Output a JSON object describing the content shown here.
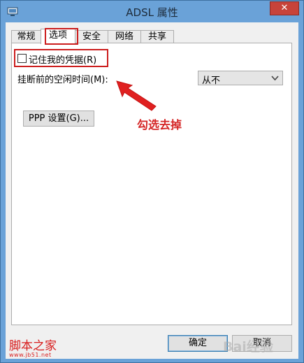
{
  "window": {
    "title": "ADSL 属性",
    "close_glyph": "✕",
    "icon": "network-connection-icon"
  },
  "tabs": [
    {
      "label": "常规",
      "active": false
    },
    {
      "label": "选项",
      "active": true
    },
    {
      "label": "安全",
      "active": false
    },
    {
      "label": "网络",
      "active": false
    },
    {
      "label": "共享",
      "active": false
    }
  ],
  "options": {
    "remember_credentials_label": "记住我的凭据(R)",
    "remember_credentials_checked": false,
    "idle_label": "挂断前的空闲时间(M):",
    "idle_value": "从不",
    "ppp_button": "PPP 设置(G)..."
  },
  "annotation": {
    "text": "勾选去掉",
    "color": "#d42323"
  },
  "buttons": {
    "ok": "确定",
    "cancel": "取消"
  },
  "watermark": {
    "site_name": "脚本之家",
    "site_url": "www.jb51.net",
    "baidu_text": "Bai经验"
  }
}
